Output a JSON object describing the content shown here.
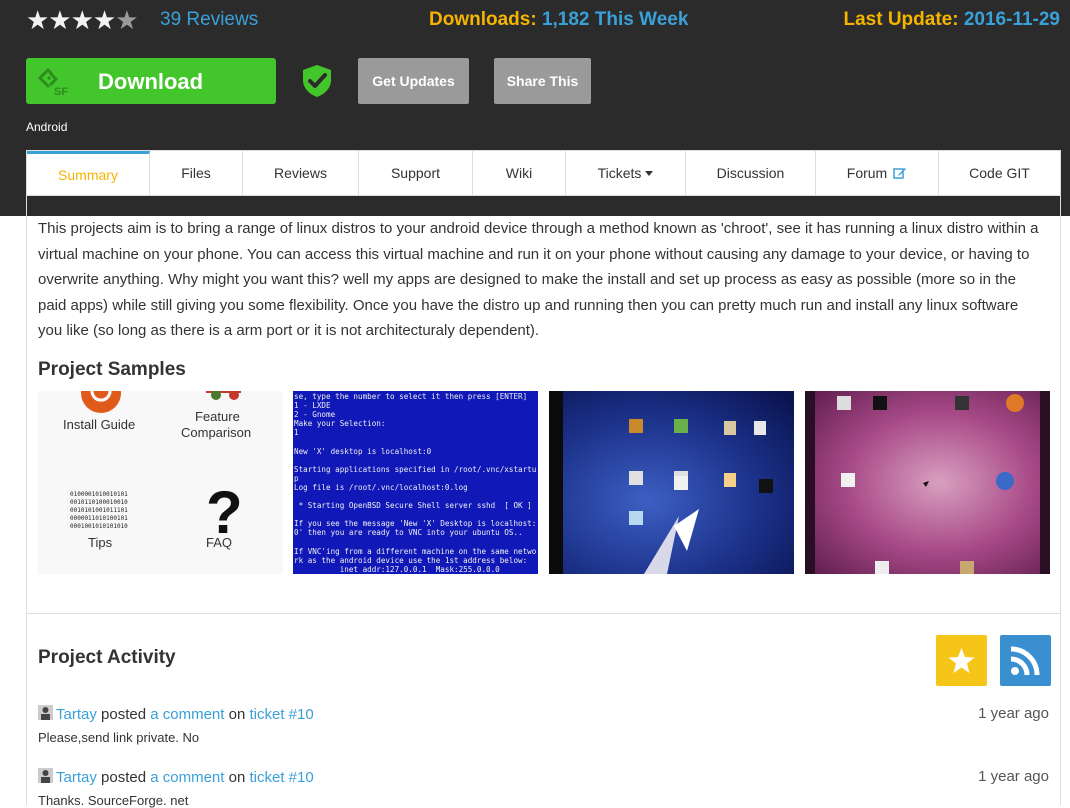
{
  "stats": {
    "stars": "★★★★",
    "half_star": "★",
    "reviews": "39 Reviews",
    "downloads_label": "Downloads:",
    "downloads_value": "1,182 This Week",
    "update_label": "Last Update:",
    "update_value": "2016-11-29"
  },
  "actions": {
    "download": "Download",
    "get_updates": "Get Updates",
    "share": "Share This",
    "platform": "Android"
  },
  "tabs": [
    "Summary",
    "Files",
    "Reviews",
    "Support",
    "Wiki",
    "Tickets",
    "Discussion",
    "Forum",
    "Code GIT"
  ],
  "summary": {
    "description": "This projects aim is to bring a range of linux distros to your android device through a method known as 'chroot', see it has running a linux distro within a virtual machine on your phone. You can access this virtual machine and run it on your phone without causing any damage to your device, or having to overwrite anything. Why might you want this? well my apps are designed to make the install and set up process as easy as possible (more so in the paid apps) while still giving you some flexibility. Once you have the distro up and running then you can pretty much run and install any linux software you like (so long as there is a arm port or it is not architecturaly dependent).",
    "samples_heading": "Project Samples"
  },
  "samples": {
    "s1": {
      "install_guide": "Install Guide",
      "feature_line1": "Feature",
      "feature_line2": "Comparison",
      "tips": "Tips",
      "faq": "FAQ"
    },
    "s2_lines": [
      "se, type the number to select it then press [ENTER]",
      "1 - LXDE",
      "2 - Gnome",
      "Make your Selection:",
      "1",
      "",
      "New 'X' desktop is localhost:0",
      "",
      "Starting applications specified in /root/.vnc/xstartu",
      "p",
      "Log file is /root/.vnc/localhost:0.log",
      "",
      " * Starting OpenBSD Secure Shell server sshd  [ OK ]",
      "",
      "If you see the message 'New 'X' Desktop is localhost:",
      "0' then you are ready to VNC into your ubuntu OS..",
      "",
      "If VNC'ing from a different machine on the same netwo",
      "rk as the android device use the 1st address below:",
      "          inet addr:127.0.0.1  Mask:255.0.0.0"
    ]
  },
  "activity": {
    "heading": "Project Activity",
    "items": [
      {
        "user": "Tartay",
        "verb": "posted",
        "link": "a comment",
        "prep": "on",
        "target": "ticket #10",
        "time": "1 year ago",
        "text": "Please,send link private. No"
      },
      {
        "user": "Tartay",
        "verb": "posted",
        "link": "a comment",
        "prep": "on",
        "target": "ticket #10",
        "time": "1 year ago",
        "text": "Thanks. SourceForge. net"
      }
    ]
  },
  "colors": {
    "accent_yellow": "#f5b400",
    "link_blue": "#3aa0d8",
    "download_green": "#43c62c",
    "header_dark": "#2b2b2b"
  }
}
